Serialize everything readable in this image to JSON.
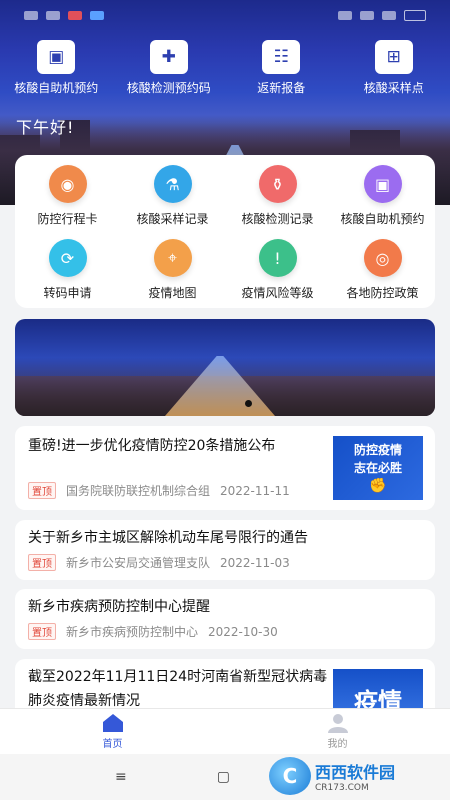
{
  "colors": {
    "accent": "#3558d8",
    "tag_red": "#e0483a"
  },
  "quick_actions": [
    {
      "label": "核酸自助机预约",
      "icon": "atm-icon"
    },
    {
      "label": "核酸检测预约码",
      "icon": "medical-kit-icon"
    },
    {
      "label": "返新报备",
      "icon": "calendar-icon"
    },
    {
      "label": "核酸采样点",
      "icon": "browser-icon"
    }
  ],
  "greeting": "下午好!",
  "services": [
    {
      "label": "防控行程卡",
      "icon": "location-card-icon",
      "color": "#f08a4b"
    },
    {
      "label": "核酸采样记录",
      "icon": "test-tube-icon",
      "color": "#33a6e8"
    },
    {
      "label": "核酸检测记录",
      "icon": "flask-icon",
      "color": "#f06a6a"
    },
    {
      "label": "核酸自助机预约",
      "icon": "kiosk-icon",
      "color": "#9b6cf0"
    },
    {
      "label": "转码申请",
      "icon": "refresh-icon",
      "color": "#34c0e8"
    },
    {
      "label": "疫情地图",
      "icon": "map-icon",
      "color": "#f3a04a"
    },
    {
      "label": "疫情风险等级",
      "icon": "shield-alert-icon",
      "color": "#3cc08a"
    },
    {
      "label": "各地防控政策",
      "icon": "eye-icon",
      "color": "#f27a4a"
    }
  ],
  "news": [
    {
      "title": "重磅!进一步优化疫情防控20条措施公布",
      "tag": "置顶",
      "source": "国务院联防联控机制综合组",
      "date": "2022-11-11",
      "thumb_lines": [
        "防控疫情",
        "志在必胜"
      ]
    },
    {
      "title": "关于新乡市主城区解除机动车尾号限行的通告",
      "tag": "置顶",
      "source": "新乡市公安局交通管理支队",
      "date": "2022-11-03"
    },
    {
      "title": "新乡市疾病预防控制中心提醒",
      "tag": "置顶",
      "source": "新乡市疾病预防控制中心",
      "date": "2022-10-30"
    },
    {
      "title": "截至2022年11月11日24时河南省新型冠状病毒肺炎疫情最新情况",
      "thumb_text": "疫情"
    }
  ],
  "tabs": [
    {
      "label": "首页",
      "icon": "home-icon"
    },
    {
      "label": "我的",
      "icon": "user-icon"
    }
  ],
  "system_nav": {
    "menu": "≡",
    "home": "▢"
  },
  "watermark": {
    "logo": "C",
    "main": "西西软件园",
    "sub": "CR173.COM"
  }
}
